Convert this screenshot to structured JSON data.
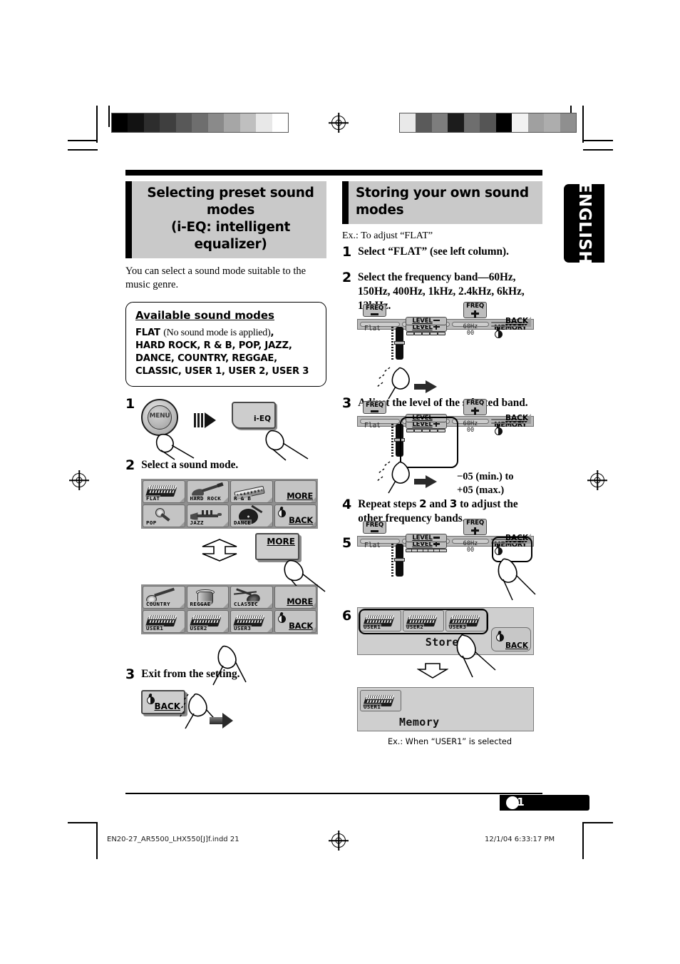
{
  "language_tab": "ENGLISH",
  "page_number": "21",
  "left_column": {
    "heading_line1": "Selecting preset sound modes",
    "heading_line2": "(i-EQ: intelligent equalizer)",
    "intro": "You can select a sound mode suitable to the music genre.",
    "info_box": {
      "title": "Available sound modes",
      "flat_label": "FLAT",
      "flat_note": "(No sound mode is applied)",
      "flat_comma": ",",
      "line2": "HARD ROCK, R & B, POP, JAZZ,",
      "line3": "DANCE, COUNTRY, REGGAE,",
      "line4": "CLASSIC, USER 1, USER 2, USER 3"
    },
    "steps": [
      {
        "num": "1",
        "text": ""
      },
      {
        "num": "2",
        "text": "Select a sound mode."
      },
      {
        "num": "3",
        "text": "Exit from the setting."
      }
    ],
    "step1_buttons": {
      "menu": "MENU",
      "ieq": "i-EQ"
    },
    "mode_grid_1": [
      {
        "label": "FLAT",
        "icon": "keyboard-icon"
      },
      {
        "label": "HARD ROCK",
        "icon": "guitar-icon"
      },
      {
        "label": "R & B",
        "icon": "harmonica-icon"
      },
      {
        "label": "MORE",
        "icon": "text-button"
      },
      {
        "label": "POP",
        "icon": "microphone-icon"
      },
      {
        "label": "JAZZ",
        "icon": "trumpet-icon"
      },
      {
        "label": "DANCE",
        "icon": "turntable-icon"
      },
      {
        "label": "BACK",
        "icon": "back-press-icon"
      }
    ],
    "mode_grid_2": [
      {
        "label": "COUNTRY",
        "icon": "banjo-icon"
      },
      {
        "label": "REGGAE",
        "icon": "conga-drum-icon"
      },
      {
        "label": "CLASSIC",
        "icon": "violin-icon"
      },
      {
        "label": "MORE",
        "icon": "text-button"
      },
      {
        "label": "USER1",
        "icon": "mixer-icon"
      },
      {
        "label": "USER2",
        "icon": "mixer-icon"
      },
      {
        "label": "USER3",
        "icon": "mixer-icon"
      },
      {
        "label": "BACK",
        "icon": "back-press-icon"
      }
    ],
    "more_button_label": "MORE",
    "back_button_label": "BACK"
  },
  "right_column": {
    "heading": "Storing your own sound modes",
    "example_intro": "Ex.: To adjust “FLAT”",
    "steps": [
      {
        "num": "1",
        "text": "Select “FLAT” (see left column)."
      },
      {
        "num": "2",
        "text": "Select the frequency band—60Hz, 150Hz, 400Hz, 1kHz, 2.4kHz, 6kHz, 12kHz."
      },
      {
        "num": "3",
        "text": "Adjust the level of the selected band."
      },
      {
        "num": "4",
        "text": "Repeat steps 2 and 3 to adjust the other frequency bands."
      },
      {
        "num": "5",
        "text": ""
      },
      {
        "num": "6",
        "text": ""
      }
    ],
    "step4_parts": {
      "a": "Repeat steps ",
      "b": "2",
      "c": " and ",
      "d": "3",
      "e": " to adjust the",
      "f": "other frequency bands."
    },
    "level_range_line1": "−05 (min.) to",
    "level_range_line2": "+05 (max.)",
    "eq_panel": {
      "mode_name": "Flat",
      "freq_minus_label": "FREQ",
      "freq_plus_label": "FREQ",
      "level_plus_label": "LEVEL",
      "level_minus_label": "LEVEL",
      "freq_value": "60Hz",
      "level_value": "00",
      "memory_label": "MEMORY",
      "back_label": "BACK"
    },
    "store_prompt": {
      "users": [
        "USER1",
        "USER2",
        "USER3"
      ],
      "text": "Store?",
      "back_label": "BACK"
    },
    "memory_result": {
      "user": "USER1",
      "text": "Memory"
    },
    "caption": "Ex.: When “USER1” is selected"
  },
  "footer": {
    "left": "EN20-27_AR5500_LHX550[J]f.indd   21",
    "right": "12/1/04   6:33:17 PM"
  },
  "color_bars": {
    "left": [
      "#000000",
      "#121212",
      "#2d2d2d",
      "#3f3f3f",
      "#585858",
      "#6e6e6e",
      "#8a8a8a",
      "#a6a6a6",
      "#bfbfbf",
      "#e8e8e8",
      "#ffffff"
    ],
    "right": [
      "#e9e9e9",
      "#5a5a5a",
      "#7d7d7d",
      "#1c1c1c",
      "#6e6e6e",
      "#555555",
      "#000000",
      "#f2f2f2",
      "#a0a0a0",
      "#adadad",
      "#8f8f8f"
    ]
  }
}
